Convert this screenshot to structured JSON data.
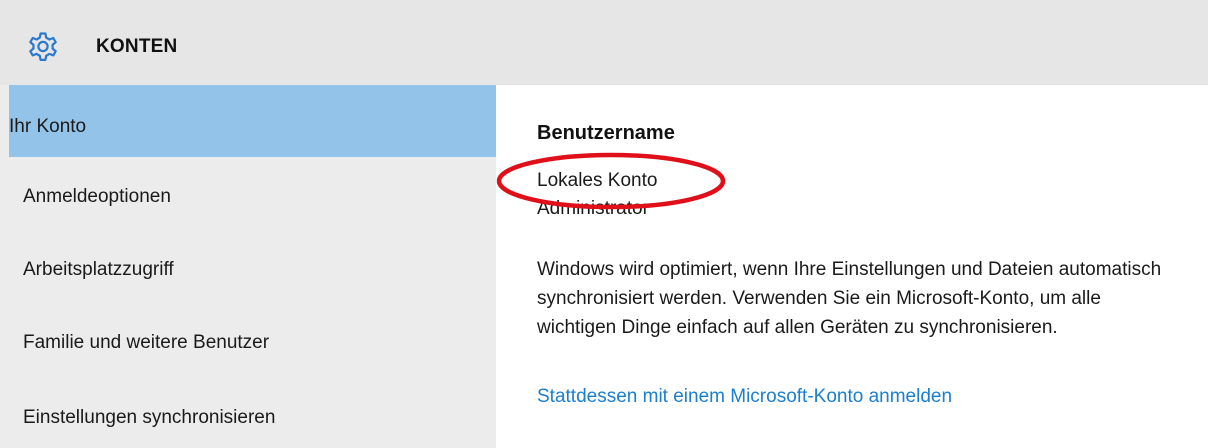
{
  "header": {
    "icon": "gear-icon",
    "title": "KONTEN"
  },
  "sidebar": {
    "items": [
      {
        "label": "Ihr Konto",
        "active": true
      },
      {
        "label": "Anmeldeoptionen",
        "active": false
      },
      {
        "label": "Arbeitsplatzzugriff",
        "active": false
      },
      {
        "label": "Familie und weitere Benutzer",
        "active": false
      },
      {
        "label": "Einstellungen synchronisieren",
        "active": false
      }
    ]
  },
  "main": {
    "section_title": "Benutzername",
    "account_type": "Lokales Konto",
    "account_name": "Administrator",
    "description": "Windows wird optimiert, wenn Ihre Einstellungen und Dateien automatisch synchronisiert werden. Verwenden Sie ein Microsoft-Konto, um alle wichtigen Dinge einfach auf allen Geräten zu synchronisieren.",
    "link_label": "Stattdessen mit einem Microsoft-Konto anmelden"
  },
  "colors": {
    "header_bg": "#e6e6e6",
    "sidebar_bg": "#ececec",
    "active_item_bg": "#94c3ea",
    "accent_icon": "#2b78d1",
    "link": "#1a7fd1",
    "highlight_annotation": "#e0101a"
  }
}
